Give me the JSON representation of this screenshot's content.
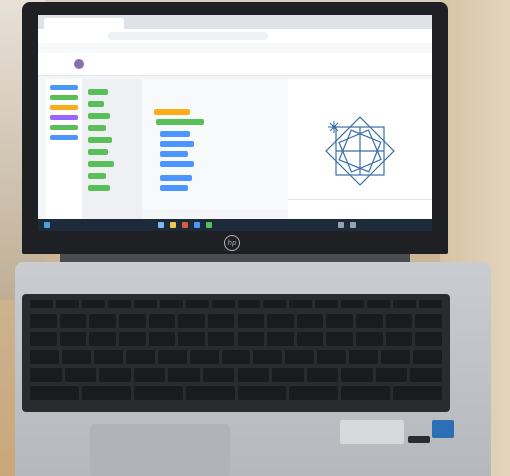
{
  "scene": {
    "subject": "laptop-on-desk"
  },
  "colors": {
    "bezel": "#1f2024",
    "deck": "#c1c4c9",
    "keyboard": "#2a2b2e",
    "key": "#1a1b1d",
    "screen_bg": "#f4f5f7",
    "taskbar": "#1c2a3a",
    "accent_purple": "#8a6fb0",
    "block_blue": "#4c97ff",
    "block_green": "#59c059",
    "block_orange": "#ffab19",
    "turtle_drawing": "#3a6ea5"
  }
}
